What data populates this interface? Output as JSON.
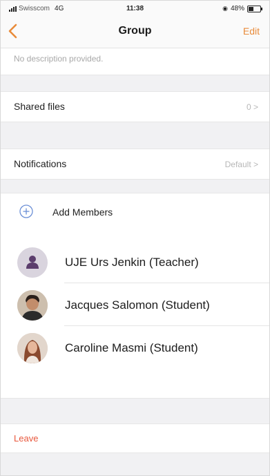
{
  "status_bar": {
    "carrier": "Swisscom",
    "network": "4G",
    "time": "11:38",
    "battery": "48%",
    "battery_level": 0.48
  },
  "nav": {
    "title": "Group",
    "edit_label": "Edit",
    "accent": "#e98b3a"
  },
  "description": "No description provided.",
  "shared_files": {
    "label": "Shared files",
    "value": "0 >"
  },
  "notifications": {
    "label": "Notifications",
    "value": "Default >"
  },
  "members": {
    "add_label": "Add Members",
    "list": [
      {
        "name": "UJE Urs Jenkin (Teacher)",
        "avatar": "person-placeholder-icon"
      },
      {
        "name": "Jacques Salomon (Student)",
        "avatar": "photo-avatar"
      },
      {
        "name": "Caroline Masmi (Student)",
        "avatar": "photo-avatar"
      }
    ]
  },
  "leave_label": "Leave",
  "colors": {
    "leave": "#e8573c",
    "add_icon": "#6b8fd6"
  }
}
